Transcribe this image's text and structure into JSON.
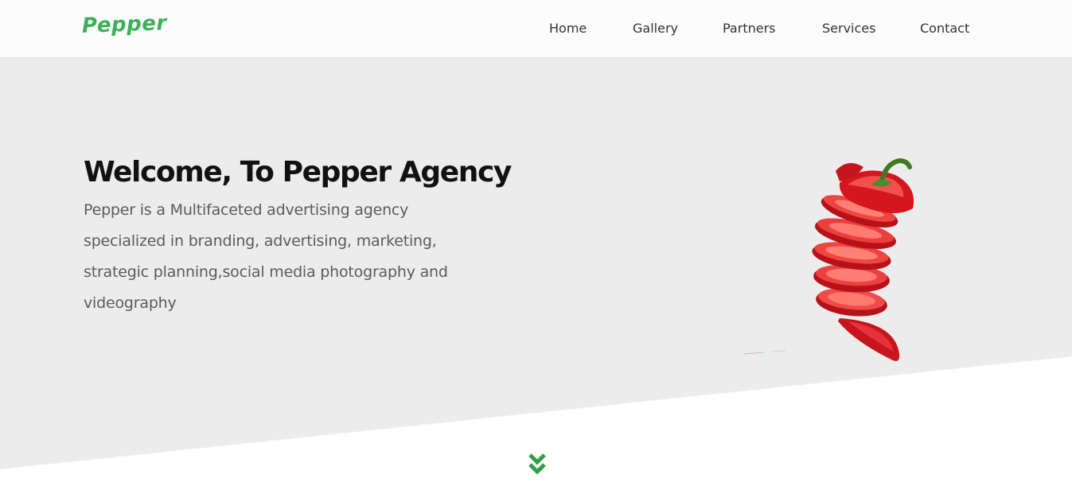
{
  "brand": {
    "name": "Pepper",
    "color": "#3eb05a"
  },
  "nav": {
    "items": [
      {
        "label": "Home"
      },
      {
        "label": "Gallery"
      },
      {
        "label": "Partners"
      },
      {
        "label": "Services"
      },
      {
        "label": "Contact"
      }
    ]
  },
  "hero": {
    "title": "Welcome, To Pepper Agency",
    "description": "Pepper is a Multifaceted advertising agency specialized in branding, advertising, marketing, strategic planning,social media photography and videography",
    "image": "sliced-red-pepper"
  },
  "scroll": {
    "icon": "double-chevron-down-icon",
    "color": "#2e9e46"
  }
}
